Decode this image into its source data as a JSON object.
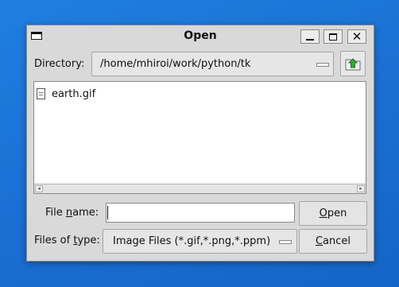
{
  "window": {
    "title": "Open"
  },
  "directory": {
    "label_pre": "Directory:",
    "value": "/home/mhiroi/work/python/tk"
  },
  "files": [
    {
      "name": "earth.gif",
      "icon": "file-icon"
    }
  ],
  "filename": {
    "label_pre": "File ",
    "label_accel": "n",
    "label_post": "ame:",
    "value": "",
    "placeholder": ""
  },
  "filetype": {
    "label_pre": "Files of ",
    "label_accel": "t",
    "label_post": "ype:",
    "value": "Image Files (*.gif,*.png,*.ppm)"
  },
  "buttons": {
    "open_accel": "O",
    "open_rest": "pen",
    "cancel_accel": "C",
    "cancel_rest": "ancel"
  },
  "colors": {
    "desktop": "#1a6ed2",
    "dialog": "#d9d9d9",
    "list_bg": "#ffffff",
    "up_arrow": "#3aa63a"
  }
}
